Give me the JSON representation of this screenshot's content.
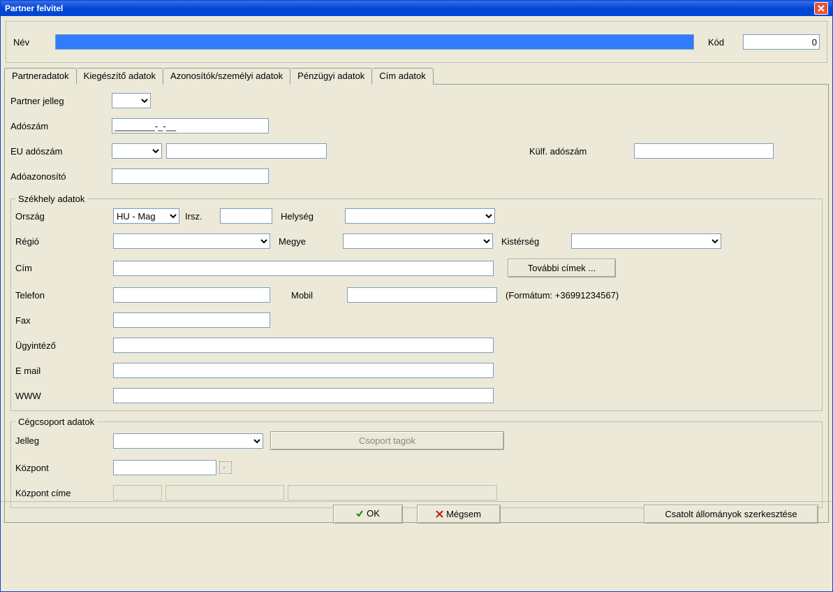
{
  "window": {
    "title": "Partner felvitel"
  },
  "header": {
    "name_label": "Név",
    "code_label": "Kód",
    "name_value": "",
    "code_value": "0"
  },
  "tabs": {
    "partner": "Partneradatok",
    "kieg": "Kiegészítő adatok",
    "azon": "Azonosítók/személyi adatok",
    "penz": "Pénzügyi adatok",
    "cim": "Cím adatok"
  },
  "form": {
    "partner_jelleg_label": "Partner jelleg",
    "adoszam_label": "Adószám",
    "adoszam_value": "________-_-__",
    "eu_adoszam_label": "EU adószám",
    "kulf_adoszam_label": "Külf. adószám",
    "adoazonosito_label": "Adóazonosító"
  },
  "szekhely": {
    "legend": "Székhely adatok",
    "orszag_label": "Ország",
    "orszag_value": "HU - Mag",
    "irsz_label": "Irsz.",
    "helyseg_label": "Helység",
    "regio_label": "Régió",
    "megye_label": "Megye",
    "kisterseg_label": "Kistérség",
    "cim_label": "Cím",
    "tovabbi_cimek": "További címek ...",
    "telefon_label": "Telefon",
    "mobil_label": "Mobil",
    "mobil_hint": "(Formátum: +36991234567)",
    "fax_label": "Fax",
    "ugyintezo_label": "Ügyintéző",
    "email_label": "E mail",
    "www_label": "WWW"
  },
  "cegcsoport": {
    "legend": "Cégcsoport adatok",
    "jelleg_label": "Jelleg",
    "csoport_tagok": "Csoport tagok",
    "kozpont_label": "Központ",
    "kozpont_cime_label": "Központ címe"
  },
  "buttons": {
    "ok": "OK",
    "cancel": "Mégsem",
    "attachments": "Csatolt állományok szerkesztése"
  }
}
